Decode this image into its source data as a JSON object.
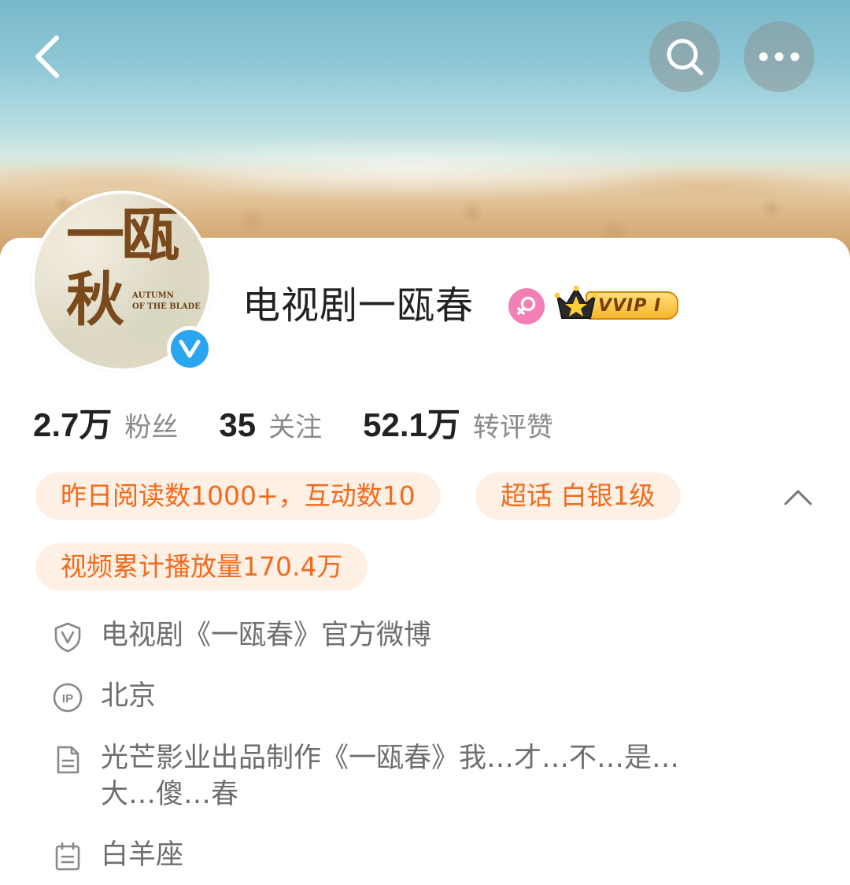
{
  "header": {
    "back_icon": "back-arrow-icon",
    "search_icon": "search-icon",
    "more_icon": "more-dots-icon"
  },
  "profile": {
    "name": "电视剧一瓯春",
    "avatar_title_big": "一瓯秋",
    "avatar_title_en": "AUTUMN OF THE BLADE",
    "verified_badge": "V",
    "gender_icon": "female-icon",
    "vip_label": "VVIP I"
  },
  "stats": [
    {
      "value": "2.7万",
      "label": "粉丝"
    },
    {
      "value": "35",
      "label": "关注"
    },
    {
      "value": "52.1万",
      "label": "转评赞"
    }
  ],
  "pills": {
    "reads": "昨日阅读数1000+，互动数10",
    "super_topic": "超话 白银1级",
    "video_plays": "视频累计播放量170.4万"
  },
  "info": {
    "verification": "电视剧《一瓯春》官方微博",
    "ip_location": "北京",
    "bio_line1": "光芒影业出品制作《一瓯春》我…才…不…是…",
    "bio_line2": "大…傻…春",
    "constellation": "白羊座"
  },
  "colors": {
    "accent_orange": "#f26a1b",
    "pill_bg": "#fff0e6",
    "verified_blue": "#2aa6f0",
    "gender_pink": "#f27fb5"
  }
}
